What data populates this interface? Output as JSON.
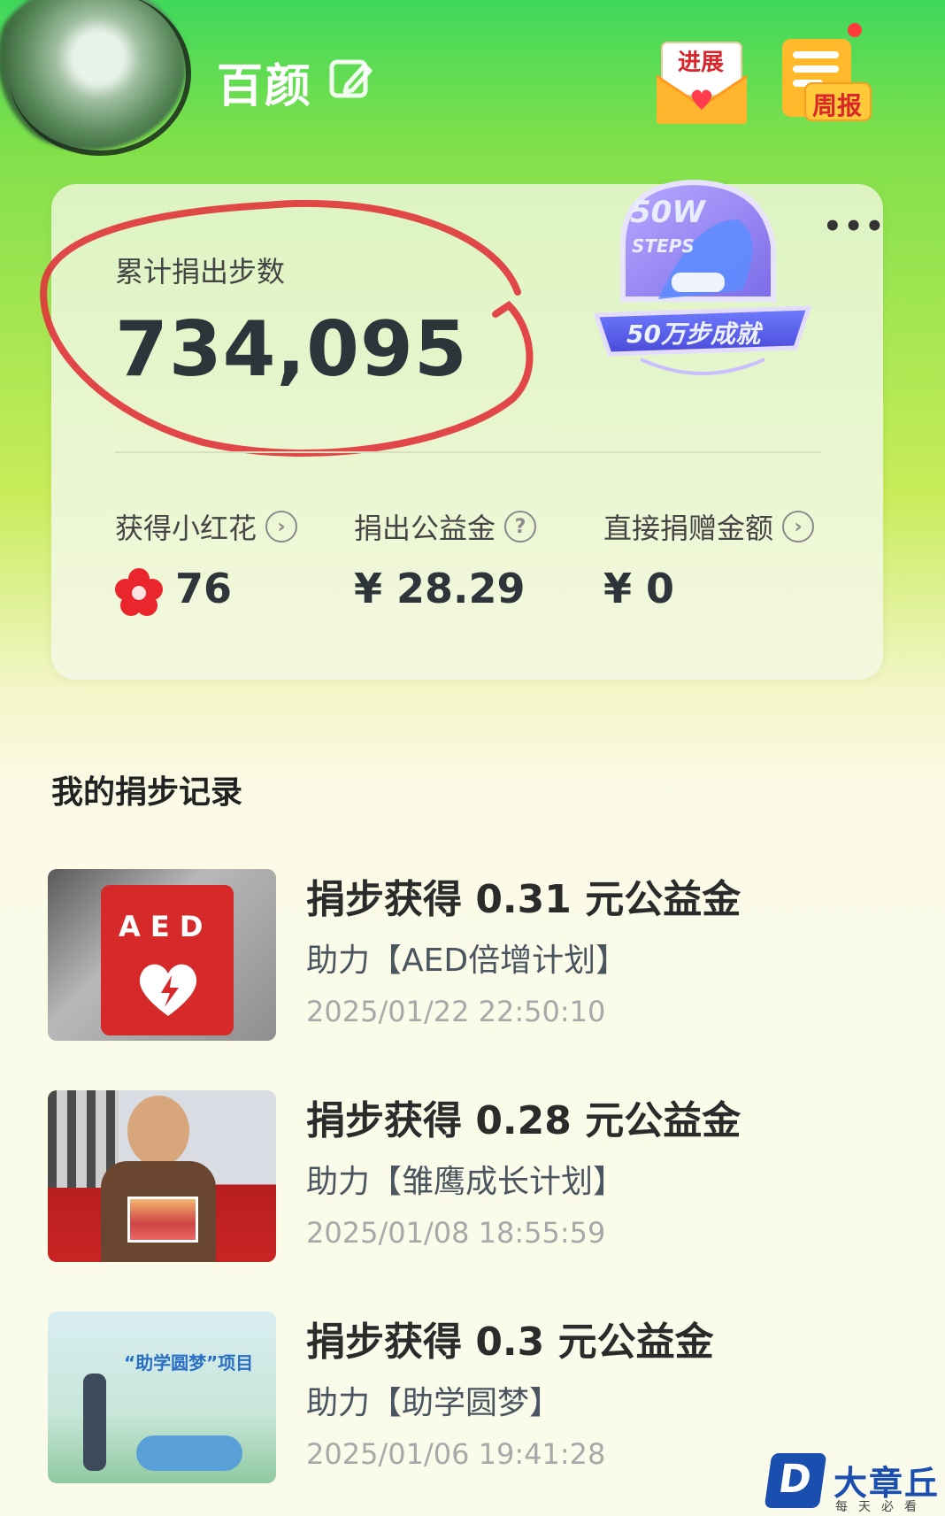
{
  "header": {
    "username": "百颜",
    "progress_label": "进展",
    "weekly_label": "周报"
  },
  "summary": {
    "total_label": "累计捐出步数",
    "total_value": "734,095",
    "badge": {
      "top_text": "50W",
      "steps_text": "STEPS",
      "ribbon_text": "50万步成就"
    },
    "stats": [
      {
        "label": "获得小红花",
        "value": "76",
        "icon": "arrow-right-circle-icon"
      },
      {
        "label": "捐出公益金",
        "value": "¥ 28.29",
        "icon": "question-circle-icon"
      },
      {
        "label": "直接捐赠金额",
        "value": "¥ 0",
        "icon": "arrow-right-circle-icon"
      }
    ]
  },
  "records": {
    "title": "我的捐步记录",
    "items": [
      {
        "title": "捐步获得 0.31 元公益金",
        "project": "助力【AED倍增计划】",
        "time": "2025/01/22 22:50:10",
        "thumb_text": "A E D"
      },
      {
        "title": "捐步获得 0.28 元公益金",
        "project": "助力【雏鹰成长计划】",
        "time": "2025/01/08 18:55:59"
      },
      {
        "title": "捐步获得 0.3 元公益金",
        "project": "助力【助学圆梦】",
        "time": "2025/01/06 19:41:28",
        "thumb_text": "“助学圆梦”项目"
      }
    ]
  },
  "watermark": {
    "text": "大章丘",
    "sub": "每天必看"
  },
  "colors": {
    "accent_green": "#3fd85c",
    "flower_red": "#e8262b",
    "badge_purple": "#7d6ee8"
  }
}
